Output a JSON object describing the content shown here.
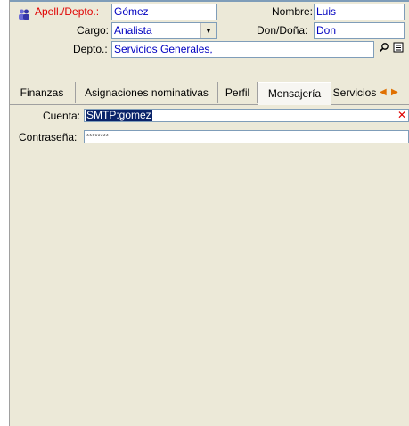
{
  "header": {
    "apell_label": "Apell./Depto.:",
    "apell_value": "Gómez",
    "nombre_label": "Nombre:",
    "nombre_value": "Luis",
    "cargo_label": "Cargo:",
    "cargo_value": "Analista",
    "don_label": "Don/Doña:",
    "don_value": "Don",
    "depto_label": "Depto.:",
    "depto_value": "Servicios Generales,"
  },
  "tabs": [
    {
      "label": "Finanzas"
    },
    {
      "label": "Asignaciones nominativas"
    },
    {
      "label": "Perfil"
    },
    {
      "label": "Mensajería"
    },
    {
      "label": "Servicios"
    }
  ],
  "active_tab": "Mensajería",
  "messaging": {
    "cuenta_label": "Cuenta:",
    "cuenta_value": "SMTP:gomez",
    "password_label": "Contraseña:",
    "password_value": "********"
  },
  "icons": [
    "user-group-icon",
    "chevron-down-icon",
    "magnifier-icon",
    "detail-icon",
    "scroll-left-icon",
    "scroll-right-icon",
    "clear-icon"
  ],
  "colors": {
    "required_label": "#e00000",
    "value_text": "#0000c0",
    "selection": "#0a246a"
  }
}
